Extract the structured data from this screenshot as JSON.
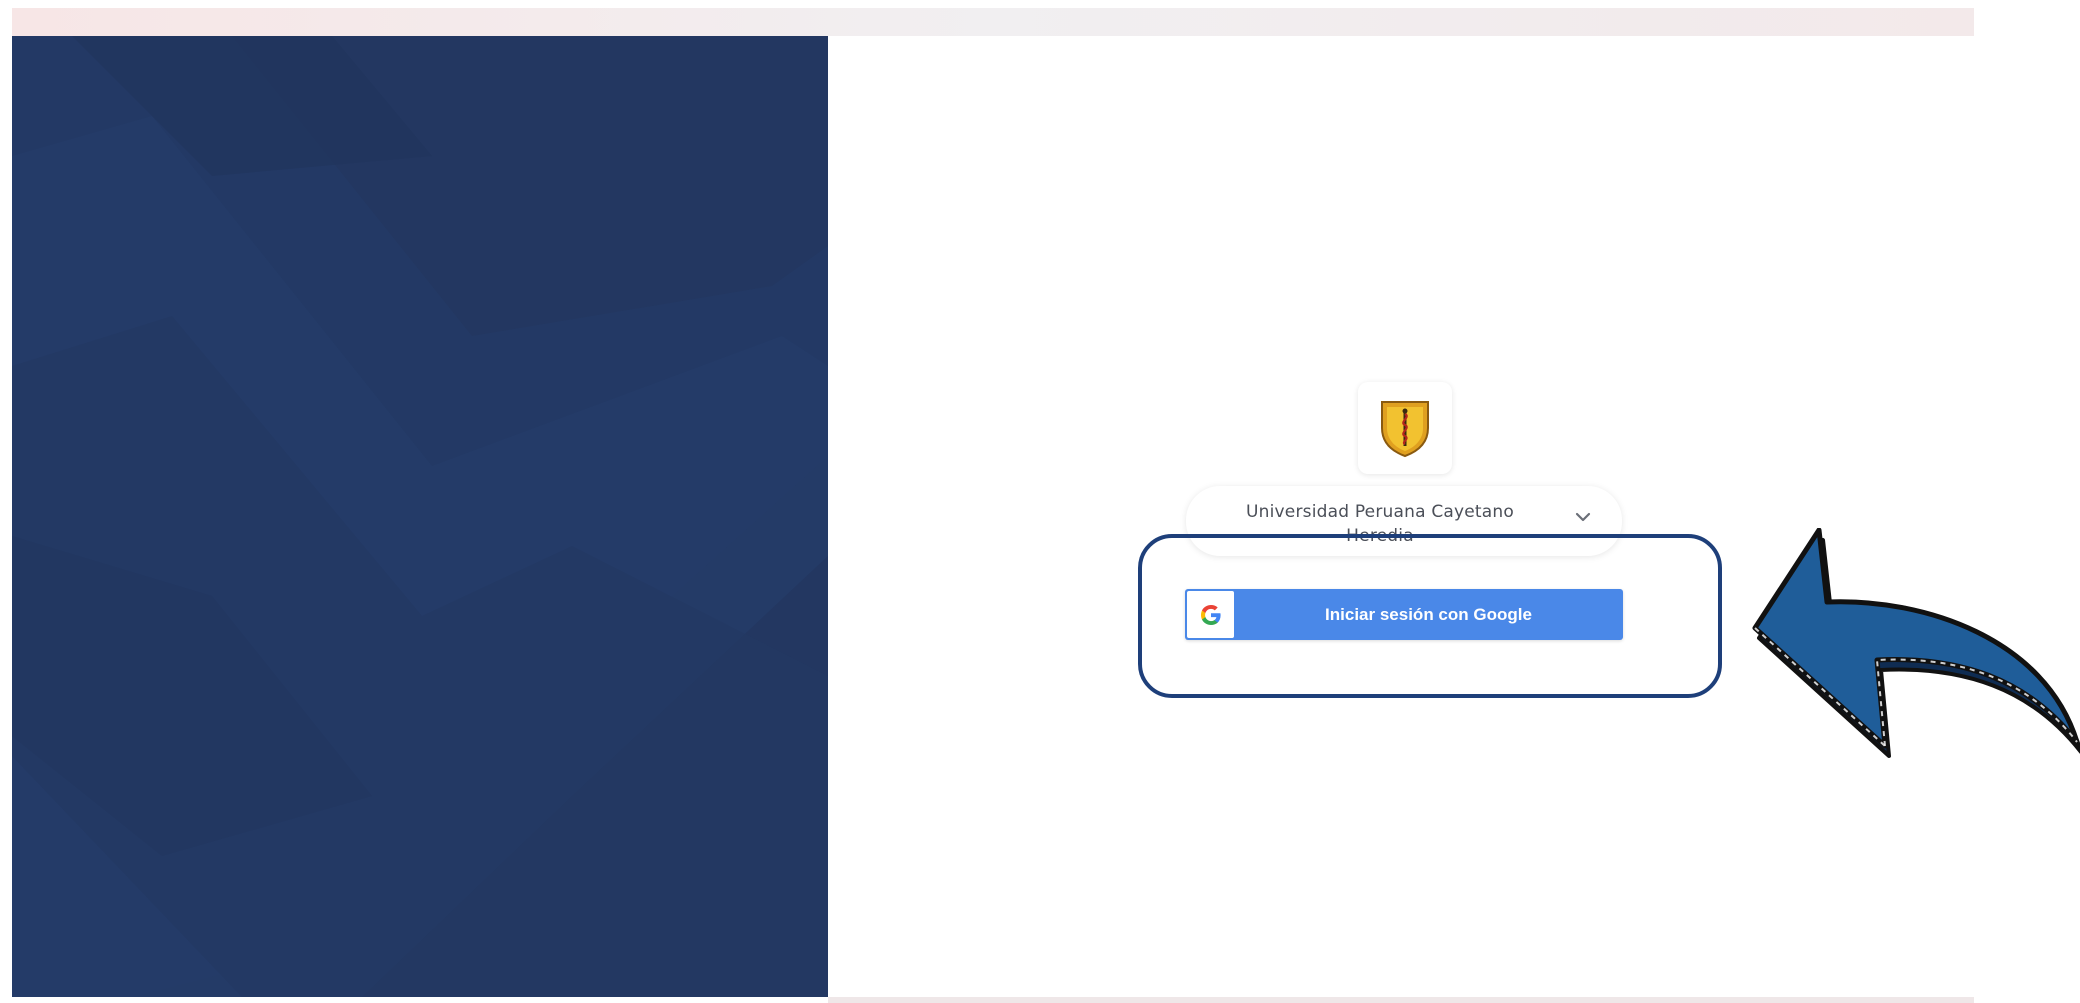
{
  "institution": {
    "name": "Universidad Peruana Cayetano Heredia",
    "logo": "shield-caduceus-icon"
  },
  "login": {
    "google_button_label": "Iniciar sesión con Google",
    "google_icon": "google-g-icon"
  },
  "annotation": {
    "arrow_icon": "curved-arrow-icon",
    "highlight_color": "#1e3f7a"
  },
  "colors": {
    "left_panel": "#233761",
    "google_button": "#4a88e8",
    "arrow_fill": "#1f5d99"
  }
}
